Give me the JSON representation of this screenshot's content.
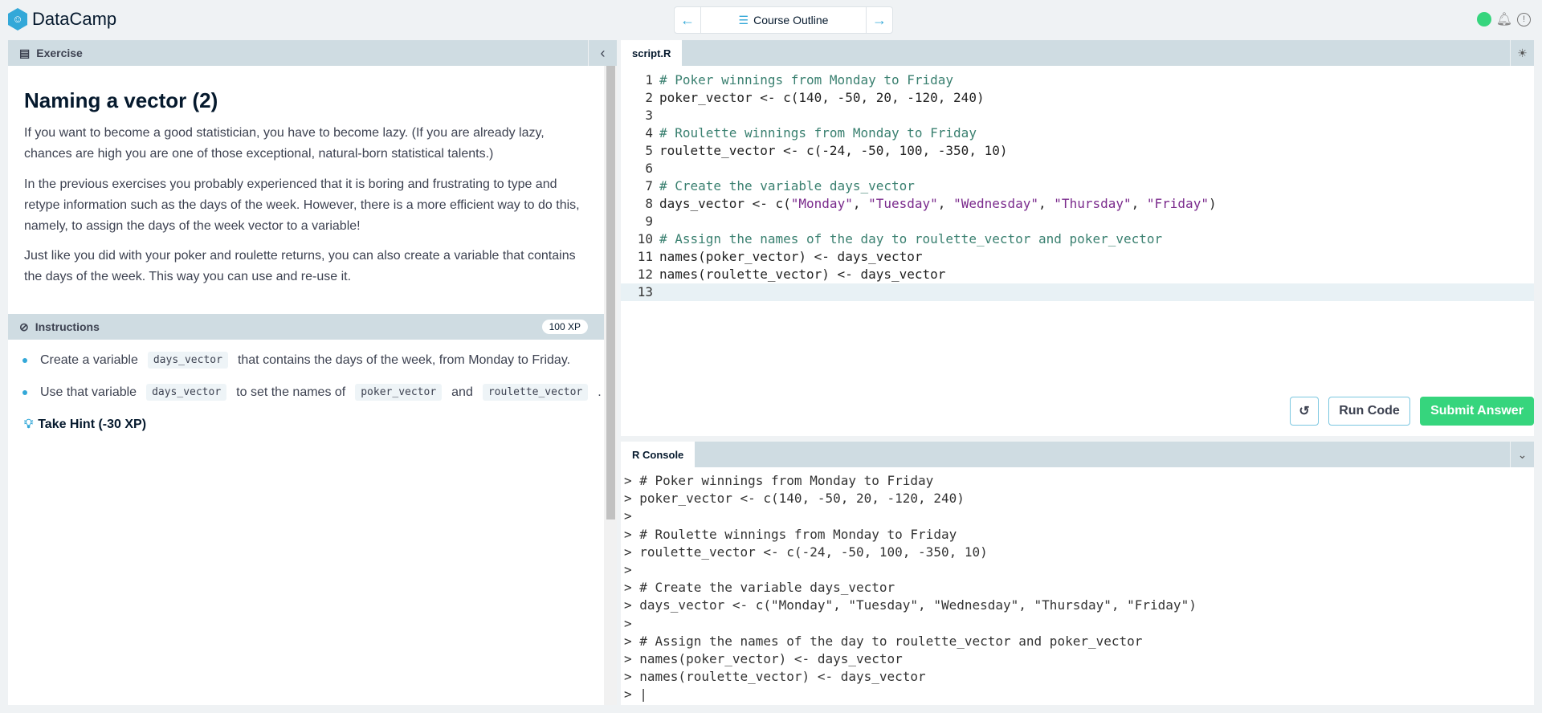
{
  "app": {
    "name": "DataCamp",
    "logo_icon": "datacamp-logo"
  },
  "nav": {
    "outline_label": "Course Outline"
  },
  "exercise": {
    "header": "Exercise",
    "title": "Naming a vector (2)",
    "paragraphs": [
      "If you want to become a good statistician, you have to become lazy. (If you are already lazy, chances are high you are one of those exceptional, natural-born statistical talents.)",
      "In the previous exercises you probably experienced that it is boring and frustrating to type and retype information such as the days of the week. However, there is a more efficient way to do this, namely, to assign the days of the week vector to a variable!",
      "Just like you did with your poker and roulette returns, you can also create a variable that contains the days of the week. This way you can use and re-use it."
    ]
  },
  "instructions": {
    "header": "Instructions",
    "xp": "100 XP",
    "b1": {
      "a": "Create a variable",
      "c1": "days_vector",
      "b": "that contains the days of the week, from Monday to Friday."
    },
    "b2": {
      "a": "Use that variable",
      "c1": "days_vector",
      "b": "to set the names of",
      "c2": "poker_vector",
      "c": "and",
      "c3": "roulette_vector",
      "d": "."
    },
    "hint": "Take Hint (-30 XP)"
  },
  "editor": {
    "tab": "script.R",
    "lines": [
      {
        "n": "1",
        "t": "# Poker winnings from Monday to Friday",
        "k": "cm"
      },
      {
        "n": "2",
        "t": "poker_vector <- c(140, -50, 20, -120, 240)",
        "k": "tx"
      },
      {
        "n": "3",
        "t": "",
        "k": "tx"
      },
      {
        "n": "4",
        "t": "# Roulette winnings from Monday to Friday",
        "k": "cm"
      },
      {
        "n": "5",
        "t": "roulette_vector <- c(-24, -50, 100, -350, 10)",
        "k": "tx"
      },
      {
        "n": "6",
        "t": "",
        "k": "tx"
      },
      {
        "n": "7",
        "t": "# Create the variable days_vector",
        "k": "cm"
      },
      {
        "n": "8",
        "t": "days_vector <- c(\"Monday\", \"Tuesday\", \"Wednesday\", \"Thursday\", \"Friday\")",
        "k": "mix"
      },
      {
        "n": "9",
        "t": "",
        "k": "tx"
      },
      {
        "n": "10",
        "t": "# Assign the names of the day to roulette_vector and poker_vector",
        "k": "cm"
      },
      {
        "n": "11",
        "t": "names(poker_vector) <- days_vector",
        "k": "tx"
      },
      {
        "n": "12",
        "t": "names(roulette_vector) <- days_vector",
        "k": "tx"
      },
      {
        "n": "13",
        "t": "",
        "k": "cur"
      }
    ],
    "run_label": "Run Code",
    "submit_label": "Submit Answer"
  },
  "console": {
    "tab": "R Console",
    "lines": [
      "> # Poker winnings from Monday to Friday",
      "> poker_vector <- c(140, -50, 20, -120, 240)",
      ">",
      "> # Roulette winnings from Monday to Friday",
      "> roulette_vector <- c(-24, -50, 100, -350, 10)",
      ">",
      "> # Create the variable days_vector",
      "> days_vector <- c(\"Monday\", \"Tuesday\", \"Wednesday\", \"Thursday\", \"Friday\")",
      ">",
      "> # Assign the names of the day to roulette_vector and poker_vector",
      "> names(poker_vector) <- days_vector",
      "> names(roulette_vector) <- days_vector",
      "> |"
    ]
  }
}
